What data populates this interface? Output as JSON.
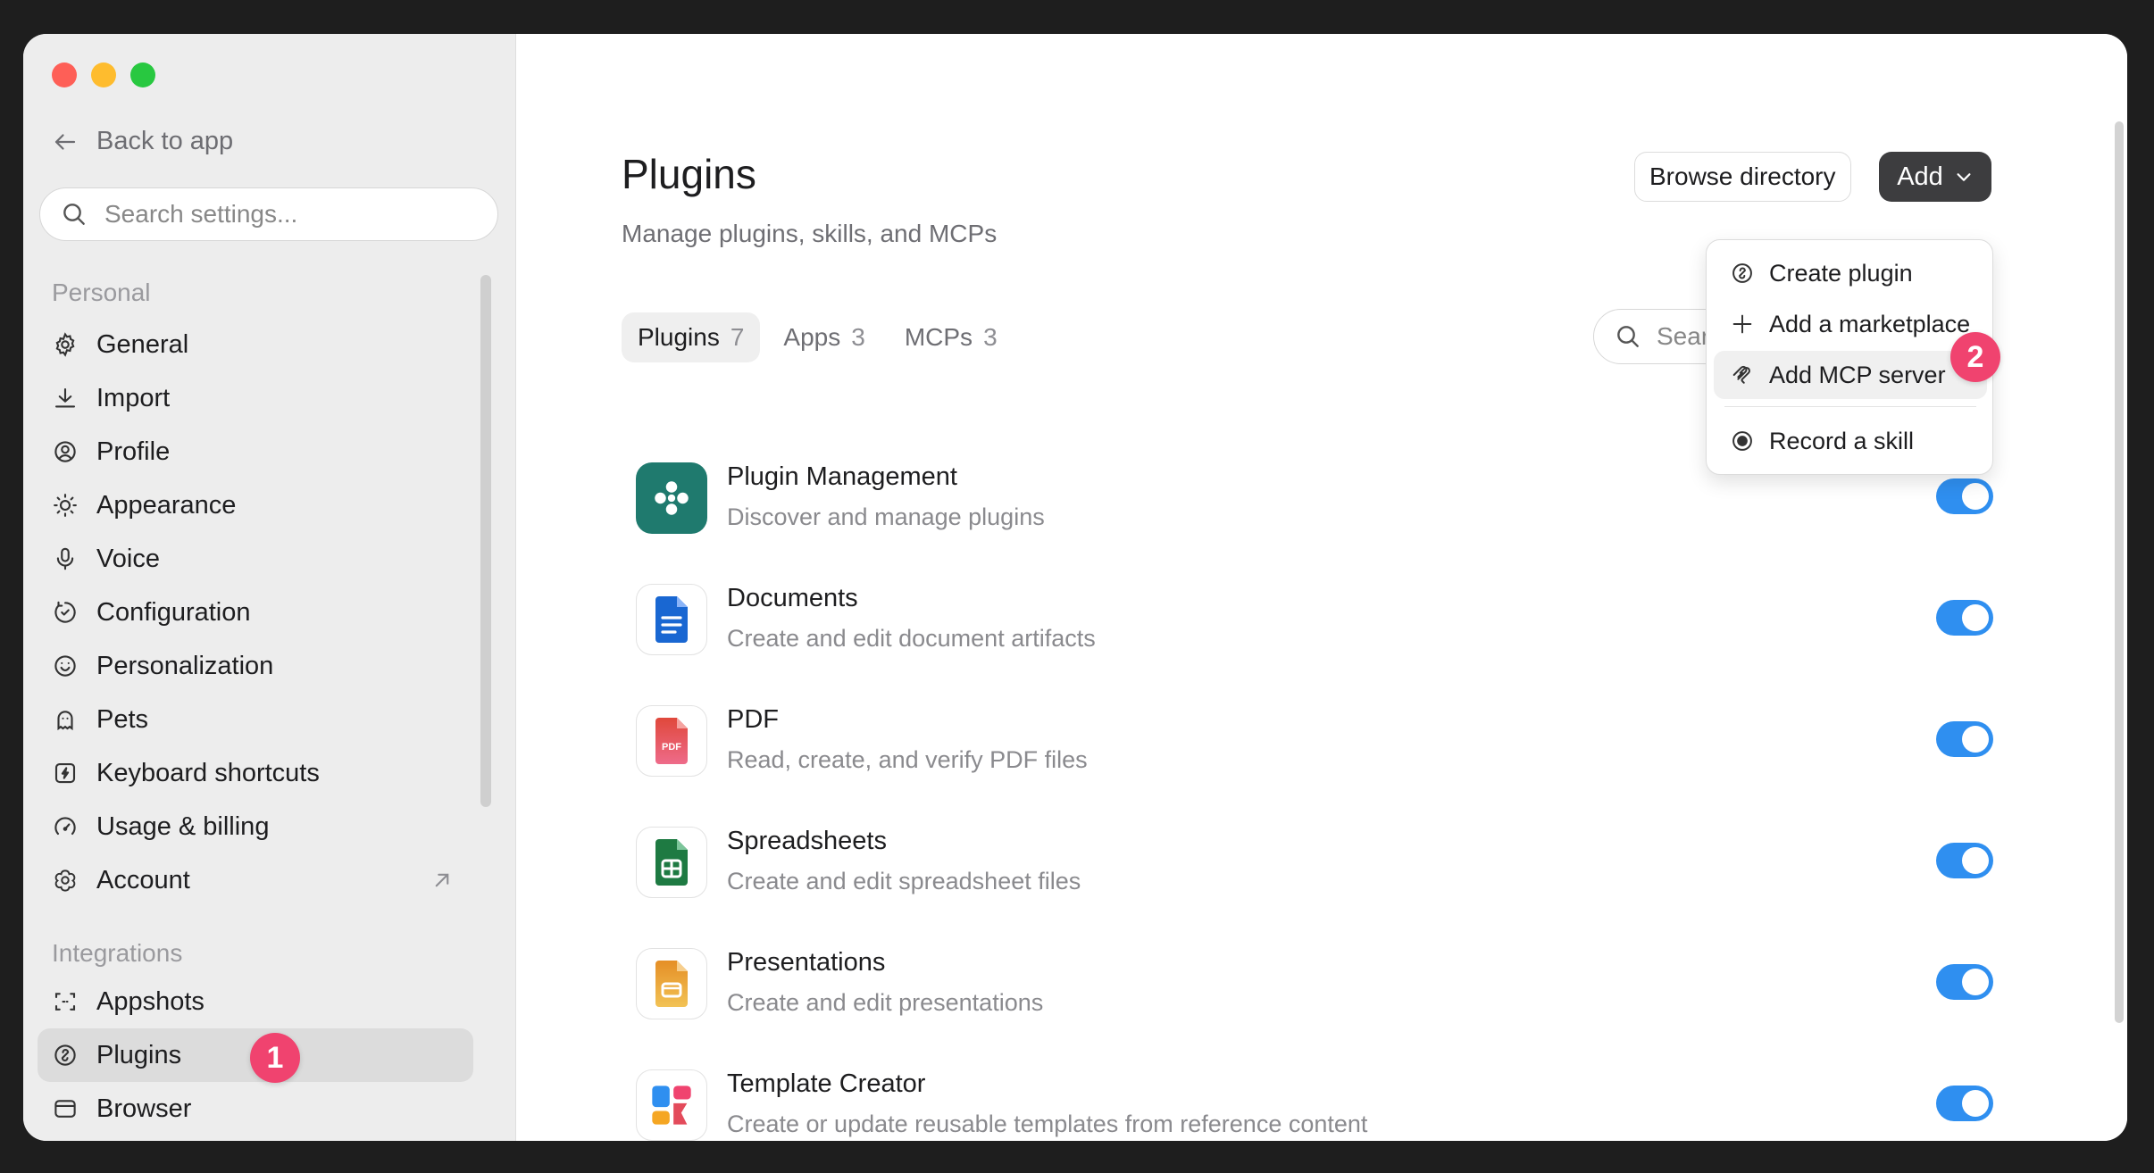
{
  "sidebar": {
    "back_label": "Back to app",
    "search_placeholder": "Search settings...",
    "sections": {
      "personal": "Personal",
      "integrations": "Integrations"
    },
    "personal_items": [
      {
        "label": "General",
        "icon": "gear-icon"
      },
      {
        "label": "Import",
        "icon": "download-icon"
      },
      {
        "label": "Profile",
        "icon": "profile-icon"
      },
      {
        "label": "Appearance",
        "icon": "sun-icon"
      },
      {
        "label": "Voice",
        "icon": "microphone-icon"
      },
      {
        "label": "Configuration",
        "icon": "configuration-icon"
      },
      {
        "label": "Personalization",
        "icon": "personalization-icon"
      },
      {
        "label": "Pets",
        "icon": "pet-icon"
      },
      {
        "label": "Keyboard shortcuts",
        "icon": "keyboard-icon"
      },
      {
        "label": "Usage & billing",
        "icon": "gauge-icon"
      },
      {
        "label": "Account",
        "icon": "account-icon"
      }
    ],
    "integration_items": [
      {
        "label": "Appshots",
        "icon": "appshots-icon"
      },
      {
        "label": "Plugins",
        "icon": "plugins-icon",
        "active": true
      },
      {
        "label": "Browser",
        "icon": "browser-icon"
      }
    ],
    "badge": "1"
  },
  "main": {
    "title": "Plugins",
    "subtitle": "Manage plugins, skills, and MCPs",
    "browse_label": "Browse directory",
    "add_label": "Add",
    "search_placeholder": "Sear",
    "tabs": [
      {
        "label": "Plugins",
        "count": "7",
        "active": true
      },
      {
        "label": "Apps",
        "count": "3"
      },
      {
        "label": "MCPs",
        "count": "3"
      }
    ],
    "plugins": [
      {
        "name": "Plugin Management",
        "description": "Discover and manage plugins",
        "icon": "plugin-management-icon",
        "enabled": true
      },
      {
        "name": "Documents",
        "description": "Create and edit document artifacts",
        "icon": "documents-icon",
        "enabled": true
      },
      {
        "name": "PDF",
        "description": "Read, create, and verify PDF files",
        "icon": "pdf-icon",
        "icon_text": "PDF",
        "enabled": true
      },
      {
        "name": "Spreadsheets",
        "description": "Create and edit spreadsheet files",
        "icon": "spreadsheets-icon",
        "enabled": true
      },
      {
        "name": "Presentations",
        "description": "Create and edit presentations",
        "icon": "presentations-icon",
        "enabled": true
      },
      {
        "name": "Template Creator",
        "description": "Create or update reusable templates from reference content",
        "icon": "template-creator-icon",
        "enabled": true
      }
    ]
  },
  "add_menu": {
    "items": [
      {
        "label": "Create plugin",
        "icon": "plugin-icon"
      },
      {
        "label": "Add a marketplace",
        "icon": "plus-icon"
      },
      {
        "label": "Add MCP server",
        "icon": "mcp-icon"
      },
      {
        "label": "Record a skill",
        "icon": "record-icon"
      }
    ],
    "badge": "2"
  },
  "colors": {
    "toggle_on": "#2f8ff0",
    "badge": "#f0436f",
    "add_button": "#3d3d3f"
  }
}
